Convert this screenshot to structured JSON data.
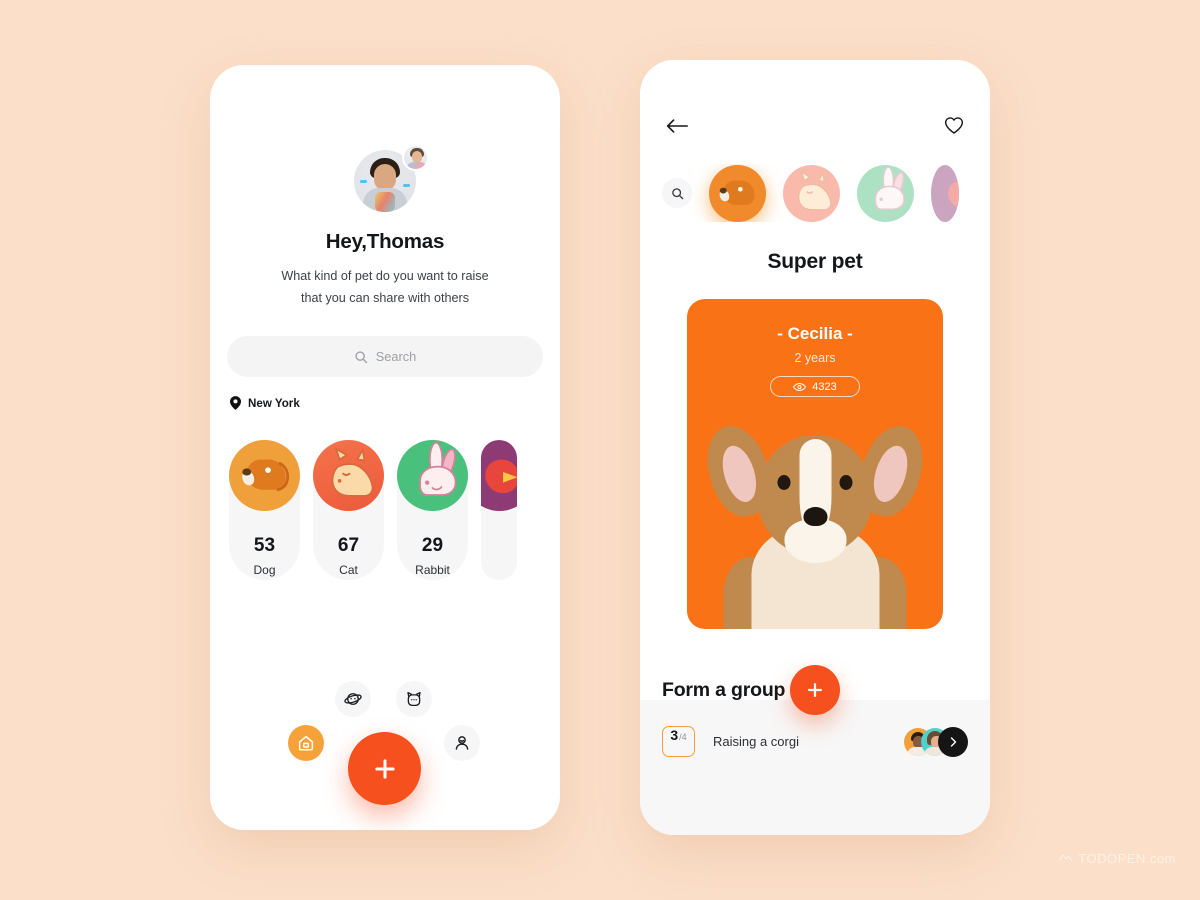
{
  "theme": {
    "background": "#fbdfc9",
    "accent_orange": "#f7501f",
    "accent_amber": "#f7a13a",
    "card_orange": "#f97316"
  },
  "screen_one": {
    "avatar": "user-avatar",
    "avatar_badge": "secondary-avatar",
    "greeting": "Hey,Thomas",
    "subtitle_line_1": "What kind of pet do you want to raise",
    "subtitle_line_2": "that you can share with others",
    "search": {
      "placeholder": "Search",
      "icon": "search-icon"
    },
    "location": {
      "label": "New York",
      "icon": "location-pin-icon"
    },
    "pets": [
      {
        "count": "53",
        "label": "Dog",
        "color": "#f0a03a",
        "icon": "dog-icon"
      },
      {
        "count": "67",
        "label": "Cat",
        "color": "#f2663c",
        "icon": "cat-icon"
      },
      {
        "count": "29",
        "label": "Rabbit",
        "color": "#49c07b",
        "icon": "rabbit-icon"
      },
      {
        "count": "",
        "label": "",
        "color": "#8e3a75",
        "icon": "bird-icon"
      }
    ],
    "nav": [
      {
        "name": "home",
        "icon": "home-icon",
        "active": true
      },
      {
        "name": "planet",
        "icon": "planet-icon",
        "active": false
      },
      {
        "name": "cat",
        "icon": "cat-face-icon",
        "active": false
      },
      {
        "name": "user",
        "icon": "user-icon",
        "active": false
      }
    ],
    "fab": {
      "icon": "plus-icon",
      "label": "+"
    }
  },
  "screen_two": {
    "back_icon": "arrow-left-icon",
    "favorite_icon": "heart-icon",
    "strip_search_icon": "search-icon",
    "strip_pets": [
      {
        "icon": "dog-icon",
        "color": "#f08a2a",
        "active": true
      },
      {
        "icon": "cat-icon",
        "color": "#f7c4b4",
        "active": false
      },
      {
        "icon": "rabbit-icon",
        "color": "#a8dcbd",
        "active": false
      },
      {
        "icon": "bird-icon",
        "color": "#b98ab5",
        "active": false
      }
    ],
    "title": "Super pet",
    "pet_card": {
      "name": "- Cecilia -",
      "age": "2 years",
      "views": "4323",
      "views_icon": "eye-icon",
      "photo": "corgi-puppy-photo"
    },
    "add_fab": {
      "icon": "plus-icon",
      "label": "+"
    },
    "group": {
      "title": "Form a group",
      "current": "3",
      "total": "/4",
      "name": "Raising a corgi",
      "members": [
        "member-avatar-1",
        "member-avatar-2"
      ],
      "chevron_icon": "chevron-right-icon"
    }
  },
  "watermark": {
    "text": "TODOPEN.com",
    "icon": "logo-mark-icon"
  }
}
